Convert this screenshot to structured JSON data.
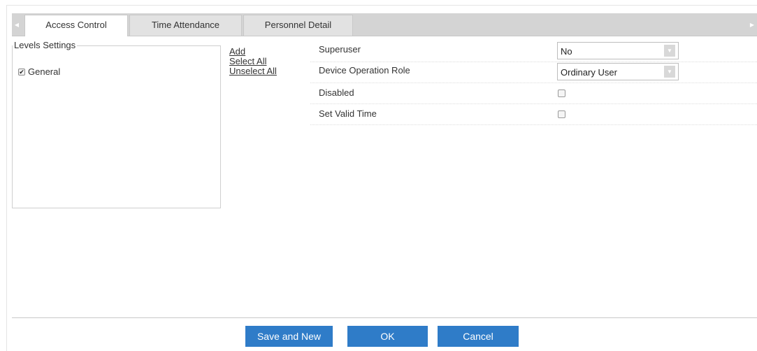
{
  "tabs": [
    {
      "label": "Access Control",
      "active": true
    },
    {
      "label": "Time Attendance",
      "active": false
    },
    {
      "label": "Personnel Detail",
      "active": false
    }
  ],
  "scroll": {
    "left_icon": "triangle-left-icon",
    "right_icon": "triangle-right-icon"
  },
  "levels": {
    "legend": "Levels Settings",
    "items": [
      {
        "label": "General",
        "checked": true
      }
    ]
  },
  "links": {
    "add": "Add",
    "select_all": "Select All",
    "unselect_all": "Unselect All"
  },
  "form": {
    "superuser": {
      "label": "Superuser",
      "value": "No"
    },
    "device_role": {
      "label": "Device Operation Role",
      "value": "Ordinary User"
    },
    "disabled": {
      "label": "Disabled",
      "checked": false
    },
    "valid_time": {
      "label": "Set Valid Time",
      "checked": false
    }
  },
  "buttons": {
    "save_new": "Save and New",
    "ok": "OK",
    "cancel": "Cancel"
  },
  "colors": {
    "primary_button": "#2f7cc8",
    "tab_bar": "#d4d4d4"
  }
}
